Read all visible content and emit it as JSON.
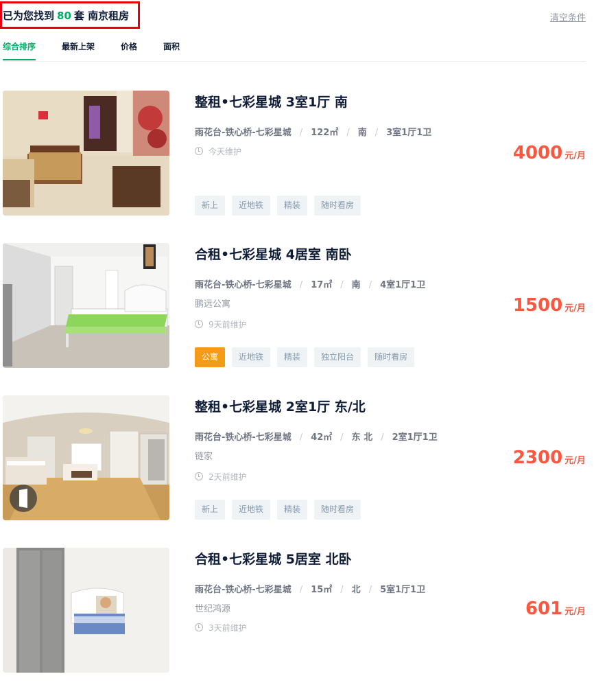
{
  "header": {
    "result_prefix": "已为您找到",
    "result_count": "80",
    "result_suffix": "套 南京租房",
    "clear_label": "清空条件"
  },
  "sort_tabs": [
    {
      "label": "综合排序",
      "active": true
    },
    {
      "label": "最新上架",
      "active": false
    },
    {
      "label": "价格",
      "active": false
    },
    {
      "label": "面积",
      "active": false
    }
  ],
  "listings": [
    {
      "title": "整租•七彩星城 3室1厅 南",
      "location": "雨花台-铁心桥-七彩星城",
      "area": "122㎡",
      "orientation": "南",
      "layout": "3室1厅1卫",
      "brand": "",
      "maintained": "今天维护",
      "tags": [
        "新上",
        "近地铁",
        "精装",
        "随时看房"
      ],
      "apartment_tag": "",
      "price": "4000",
      "price_unit": "元/月"
    },
    {
      "title": "合租•七彩星城 4居室 南卧",
      "location": "雨花台-铁心桥-七彩星城",
      "area": "17㎡",
      "orientation": "南",
      "layout": "4室1厅1卫",
      "brand": "鹏远公寓",
      "maintained": "9天前维护",
      "tags": [
        "近地铁",
        "精装",
        "独立阳台",
        "随时看房"
      ],
      "apartment_tag": "公寓",
      "price": "1500",
      "price_unit": "元/月"
    },
    {
      "title": "整租•七彩星城 2室1厅 东/北",
      "location": "雨花台-铁心桥-七彩星城",
      "area": "42㎡",
      "orientation": "东 北",
      "layout": "2室1厅1卫",
      "brand": "链家",
      "maintained": "2天前维护",
      "tags": [
        "新上",
        "近地铁",
        "精装",
        "随时看房"
      ],
      "apartment_tag": "",
      "price": "2300",
      "price_unit": "元/月"
    },
    {
      "title": "合租•七彩星城 5居室 北卧",
      "location": "雨花台-铁心桥-七彩星城",
      "area": "15㎡",
      "orientation": "北",
      "layout": "5室1厅1卫",
      "brand": "世纪鸿源",
      "maintained": "3天前维护",
      "tags": [],
      "apartment_tag": "",
      "price": "601",
      "price_unit": "元/月"
    }
  ],
  "colors": {
    "accent_green": "#00ae66",
    "price_red": "#fa5741",
    "apartment_orange": "#f69b17",
    "highlight_box": "#e60012"
  }
}
